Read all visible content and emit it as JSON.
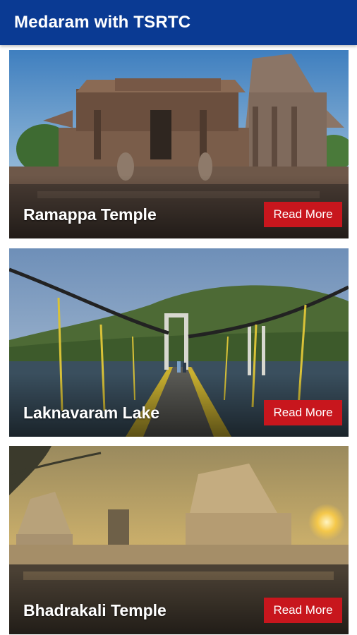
{
  "appbar": {
    "title": "Medaram with TSRTC",
    "color": "#0a3a93"
  },
  "accent": "#c8161d",
  "cards": [
    {
      "title": "Ramappa Temple",
      "button_label": "Read More",
      "image": "temple-photo"
    },
    {
      "title": "Laknavaram Lake",
      "button_label": "Read More",
      "image": "suspension-bridge-lake-photo"
    },
    {
      "title": "Bhadrakali Temple",
      "button_label": "Read More",
      "image": "temple-sunset-photo"
    }
  ]
}
